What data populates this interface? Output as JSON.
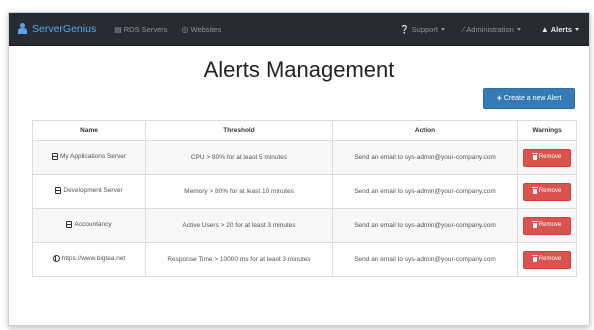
{
  "navbar": {
    "brand": "ServerGenius",
    "items_left": [
      {
        "label": "RDS Servers",
        "icon": "server-icon"
      },
      {
        "label": "Websites",
        "icon": "globe-icon"
      }
    ],
    "items_right": [
      {
        "label": "Support",
        "icon": "question-icon"
      },
      {
        "label": "Administration",
        "icon": "wrench-icon"
      },
      {
        "label": "Alerts",
        "icon": "bell-icon"
      }
    ]
  },
  "page": {
    "title": "Alerts Management",
    "create_label": "Create a new Alert"
  },
  "table": {
    "headers": [
      "Name",
      "Threshold",
      "Action",
      "Warnings"
    ],
    "rows": [
      {
        "icon": "server-icon",
        "name": "My Applications Server",
        "threshold": "CPU > 80% for at least 5 minutes",
        "action": "Send an email to sys-admin@your-company.com",
        "button": "Remove"
      },
      {
        "icon": "server-icon",
        "name": "Development Server",
        "threshold": "Memory > 80% for at least 10 minutes",
        "action": "Send an email to sys-admin@your-company.com",
        "button": "Remove"
      },
      {
        "icon": "server-icon",
        "name": "Accountancy",
        "threshold": "Active Users > 20 for at least 3 minutes",
        "action": "Send an email to sys-admin@your-company.com",
        "button": "Remove"
      },
      {
        "icon": "globe-icon",
        "name": "https://www.bigtea.net",
        "threshold": "Response Time > 10000 ms for at least 3 minutes",
        "action": "Send an email to sys-admin@your-company.com",
        "button": "Remove"
      }
    ]
  },
  "colors": {
    "navbar_bg": "#272c33",
    "brand": "#5aa5ea",
    "primary_button": "#337ab7",
    "danger_button": "#d9534f"
  }
}
